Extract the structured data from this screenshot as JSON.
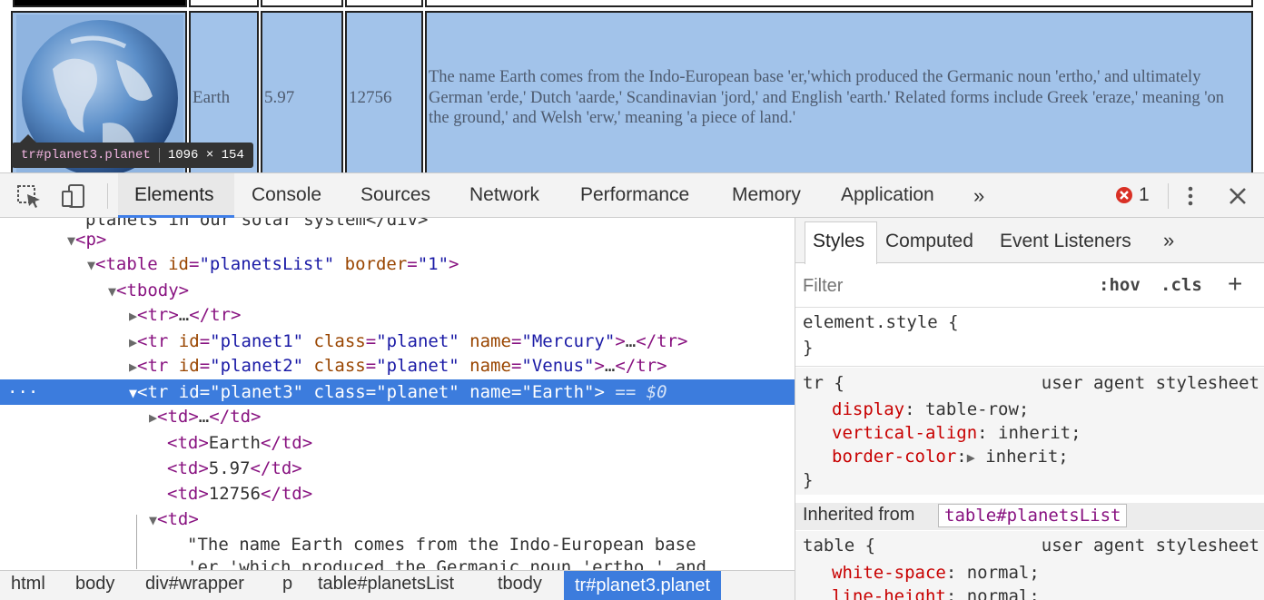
{
  "page": {
    "row": {
      "name": "Earth",
      "mass": "5.97",
      "diameter": "12756",
      "description": "The name Earth comes from the Indo-European base 'er,'which produced the Germanic noun 'ertho,' and ultimately German 'erde,' Dutch 'aarde,' Scandinavian 'jord,' and English 'earth.' Related forms include Greek 'eraze,' meaning 'on the ground,' and Welsh 'erw,' meaning 'a piece of land.'"
    },
    "tooltip": {
      "selector": "tr#planet3.planet",
      "size": "1096 × 154"
    }
  },
  "toolbar": {
    "tabs": [
      "Elements",
      "Console",
      "Sources",
      "Network",
      "Performance",
      "Memory",
      "Application"
    ],
    "more": "»",
    "error_count": "1"
  },
  "dom": {
    "lines": [
      {
        "text": "planets in our solar system</div>"
      },
      {
        "text": "<p>"
      },
      {
        "text": "<table id=\"planetsList\" border=\"1\">"
      },
      {
        "text": "<tbody>"
      },
      {
        "text": "<tr>…</tr>"
      },
      {
        "text": "<tr id=\"planet1\" class=\"planet\" name=\"Mercury\">…</tr>"
      },
      {
        "text": "<tr id=\"planet2\" class=\"planet\" name=\"Venus\">…</tr>"
      },
      {
        "text": "<tr id=\"planet3\" class=\"planet\" name=\"Earth\"> == $0"
      },
      {
        "text": "<td>…</td>"
      },
      {
        "text": "<td>Earth</td>"
      },
      {
        "text": "<td>5.97</td>"
      },
      {
        "text": "<td>12756</td>"
      },
      {
        "text": "<td>"
      },
      {
        "text": "\"The name Earth comes from the Indo-European base"
      },
      {
        "text": "'er,'which produced the Germanic noun 'ertho,' and"
      }
    ],
    "selected_index": 7,
    "ellipsis": "…"
  },
  "breadcrumbs": [
    "html",
    "body",
    "div#wrapper",
    "p",
    "table#planetsList",
    "tbody",
    "tr#planet3.planet"
  ],
  "styles": {
    "tabs": [
      "Styles",
      "Computed",
      "Event Listeners"
    ],
    "more": "»",
    "filter_placeholder": "Filter",
    "hov": ":hov",
    "cls": ".cls",
    "add": "+",
    "element_style": {
      "selector": "element.style {",
      "close": "}"
    },
    "tr_rule": {
      "selector": "tr {",
      "source": "user agent stylesheet",
      "props": [
        {
          "name": "display",
          "value": "table-row;"
        },
        {
          "name": "vertical-align",
          "value": "inherit;"
        },
        {
          "name": "border-color",
          "value": "inherit;"
        }
      ],
      "close": "}"
    },
    "inherited_label": "Inherited from",
    "inherited_from": "table#planetsList",
    "table_rule": {
      "selector": "table {",
      "source": "user agent stylesheet",
      "props": [
        {
          "name": "white-space",
          "value": "normal;"
        },
        {
          "name": "line-height",
          "value": "normal;"
        }
      ]
    }
  },
  "colors": {
    "accent": "#3c7cdd",
    "row_highlight": "#a2c3ea",
    "error": "#d93025"
  }
}
